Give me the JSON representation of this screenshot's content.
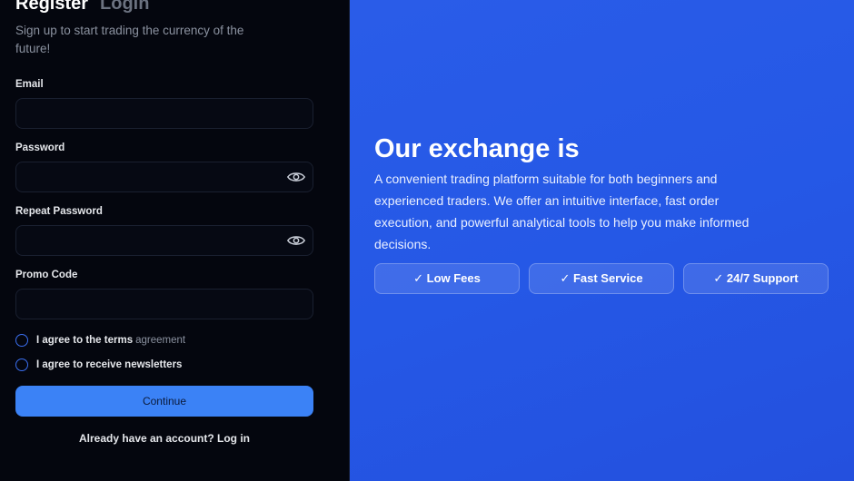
{
  "tabs": {
    "register": "Register",
    "login": "Login"
  },
  "subtitle": "Sign up to start trading the currency of the future!",
  "fields": {
    "email": {
      "label": "Email",
      "value": "",
      "placeholder": ""
    },
    "password": {
      "label": "Password",
      "value": "",
      "placeholder": ""
    },
    "repeat_password": {
      "label": "Repeat Password",
      "value": "",
      "placeholder": ""
    },
    "promo": {
      "label": "Promo Code",
      "value": "",
      "placeholder": ""
    }
  },
  "checks": {
    "terms": {
      "label": "I agree to the terms",
      "suffix": "agreement"
    },
    "newsletter": {
      "label": "I agree to receive newsletters"
    }
  },
  "continue_label": "Continue",
  "login_prompt": "Already have an account? Log in",
  "hero": {
    "title": "Our exchange is",
    "description": "A convenient trading platform suitable for both beginners and experienced traders. We offer an intuitive interface, fast order execution, and powerful analytical tools to help you make informed decisions.",
    "features": [
      "✓ Low Fees",
      "✓ Fast Service",
      "✓ 24/7 Support"
    ]
  },
  "colors": {
    "accent": "#3b82f6",
    "hero_bg": "#2558e6",
    "panel_bg": "#04060e"
  }
}
